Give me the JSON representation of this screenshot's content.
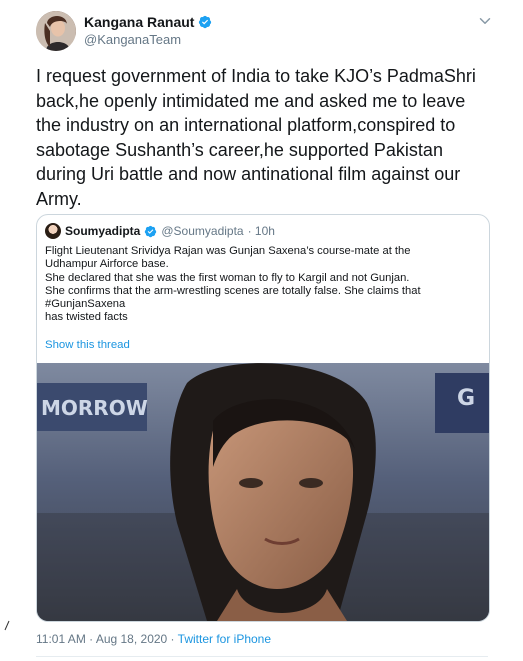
{
  "author": {
    "name": "Kangana Ranaut",
    "handle": "@KanganaTeam",
    "verified": true
  },
  "tweet": {
    "lines": [
      "I request government of India to take KJO’s PadmaShri",
      "back,he openly intimidated me and asked me to leave",
      "the industry on an international platform,conspired to",
      "sabotage Sushanth’s career,he supported Pakistan",
      "during Uri battle and now antinational film against our",
      "Army."
    ]
  },
  "quoted": {
    "name": "Soumyadipta",
    "handle": "@Soumyadipta",
    "time": "· 10h",
    "lines": [
      "Flight Lieutenant Srividya Rajan was Gunjan Saxena’s course-mate at the",
      "Udhampur Airforce base.",
      "She declared that she was the first woman to fly to Kargil and not Gunjan.",
      "She confirms that the arm-wrestling scenes are totally false. She claims that",
      "#GunjanSaxena",
      "has twisted facts"
    ],
    "show_thread": "Show this thread",
    "image_text_left": "MORROW",
    "image_text_right": "G"
  },
  "footer": {
    "timestamp": "11:01 AM · Aug 18, 2020 · ",
    "source": "Twitter for iPhone"
  },
  "colors": {
    "link": "#1b95e0",
    "muted": "#657786",
    "border": "#ccd6dd",
    "verified": "#1da1f2"
  },
  "icons": [
    "verified-badge-icon",
    "chevron-down-icon"
  ]
}
